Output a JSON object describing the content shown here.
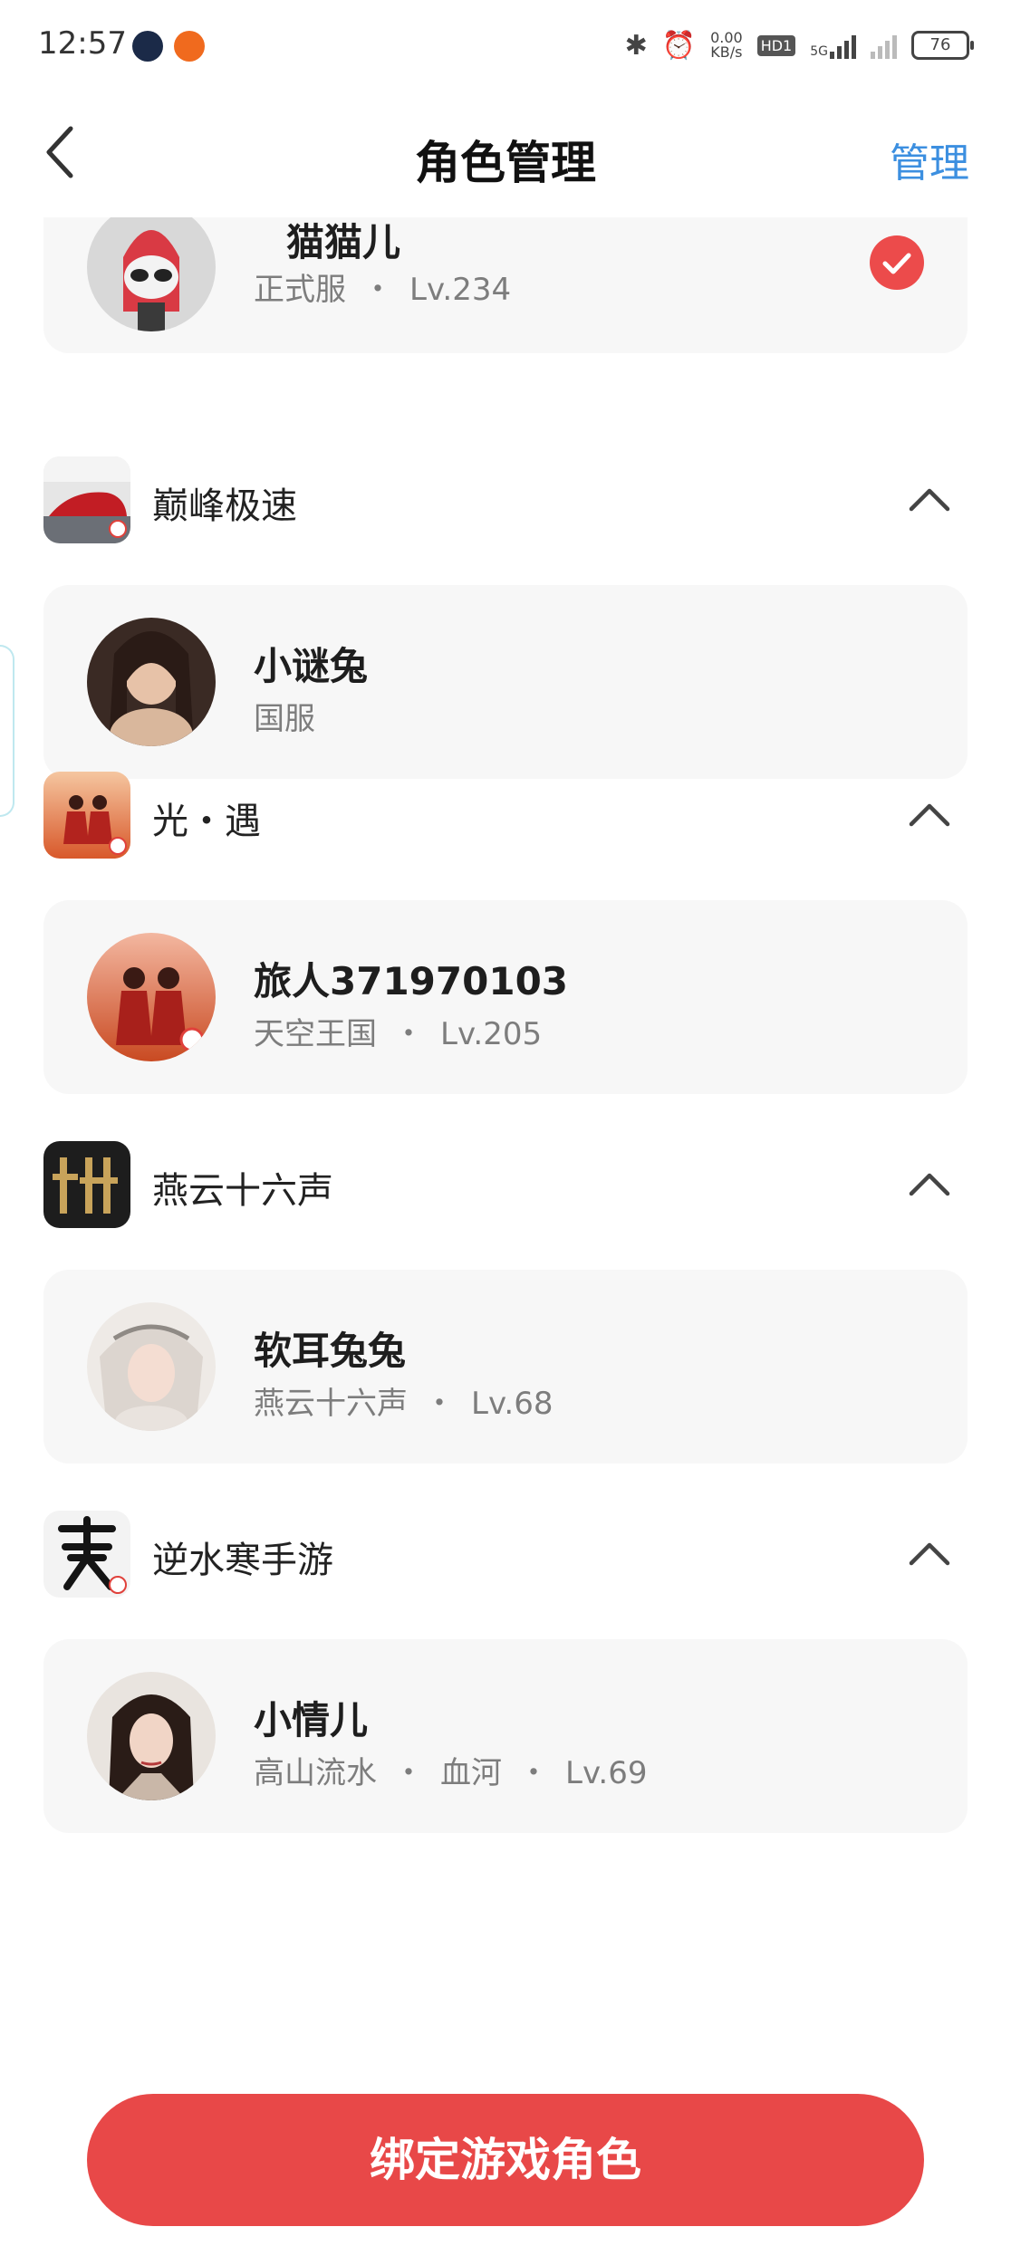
{
  "status_bar": {
    "time": "12:57",
    "net_speed_value": "0.00",
    "net_speed_unit": "KB/s",
    "hd_label": "HD1",
    "network": "5G",
    "battery": "76"
  },
  "header": {
    "title": "角色管理",
    "manage_label": "管理"
  },
  "groups": [
    {
      "game": "",
      "role": {
        "name": "猫猫儿",
        "server": "正式服",
        "level": "Lv.234",
        "selected": true
      }
    },
    {
      "game": "巅峰极速",
      "role": {
        "name": "小谜兔",
        "server": "国服"
      }
    },
    {
      "game": "光・遇",
      "role": {
        "name": "旅人371970103",
        "server": "天空王国",
        "level": "Lv.205"
      }
    },
    {
      "game": "燕云十六声",
      "role": {
        "name": "软耳兔兔",
        "server": "燕云十六声",
        "level": "Lv.68"
      }
    },
    {
      "game": "逆水寒手游",
      "role": {
        "name": "小情儿",
        "server": "高山流水",
        "extra": "血河",
        "level": "Lv.69"
      }
    }
  ],
  "separator": "・",
  "bind_button_label": "绑定游戏角色",
  "colors": {
    "accent_red": "#e84848",
    "link_blue": "#3c8fe0",
    "card_bg": "#f7f7f7"
  }
}
